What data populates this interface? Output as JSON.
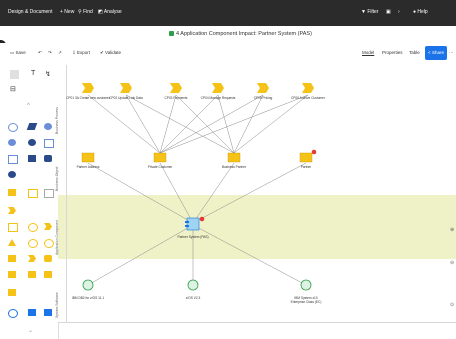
{
  "topbar": {
    "menu_label": "Design & Document",
    "new_label": "+ New",
    "find_label": "Find",
    "analyse_label": "Analyse",
    "filter_label": "Filter",
    "help_label": "Help"
  },
  "document": {
    "title": "4 Application Component Impact: Partner System (PAS)"
  },
  "toolbar": {
    "save_label": "Save",
    "export_label": "Export",
    "validate_label": "Validate",
    "tabs": [
      "Model",
      "Properties",
      "Table"
    ],
    "share_label": "Share"
  },
  "lanes": [
    {
      "label": "Business Process"
    },
    {
      "label": "Business Object"
    },
    {
      "label": "Application Component"
    },
    {
      "label": "System Software"
    }
  ],
  "processes": [
    {
      "label": "CP01 3A Create new customer"
    },
    {
      "label": "CP02 Update Link Data"
    },
    {
      "label": "CP03 Payments"
    },
    {
      "label": "CP04 Manage Requests"
    },
    {
      "label": "CP05 Pricing"
    },
    {
      "label": "CP06 Archive Customer"
    }
  ],
  "objects": [
    {
      "label": "Partner Address"
    },
    {
      "label": "Private Customer"
    },
    {
      "label": "Business Partner"
    },
    {
      "label": "Partner"
    }
  ],
  "component": {
    "label": "Partner System (PAS)"
  },
  "software": [
    {
      "label": "IBM DB2 for z/OS 11.1"
    },
    {
      "label": "z/OS V2.3"
    },
    {
      "label": "IBM System z10 Enterprise Class (EC)"
    }
  ],
  "colors": {
    "process": "#f5c218",
    "object": "#f5c218",
    "component_lane": "#eef2c6",
    "software": "#2e9e4a",
    "accent": "#1a73e8",
    "marker": "#e53935"
  }
}
